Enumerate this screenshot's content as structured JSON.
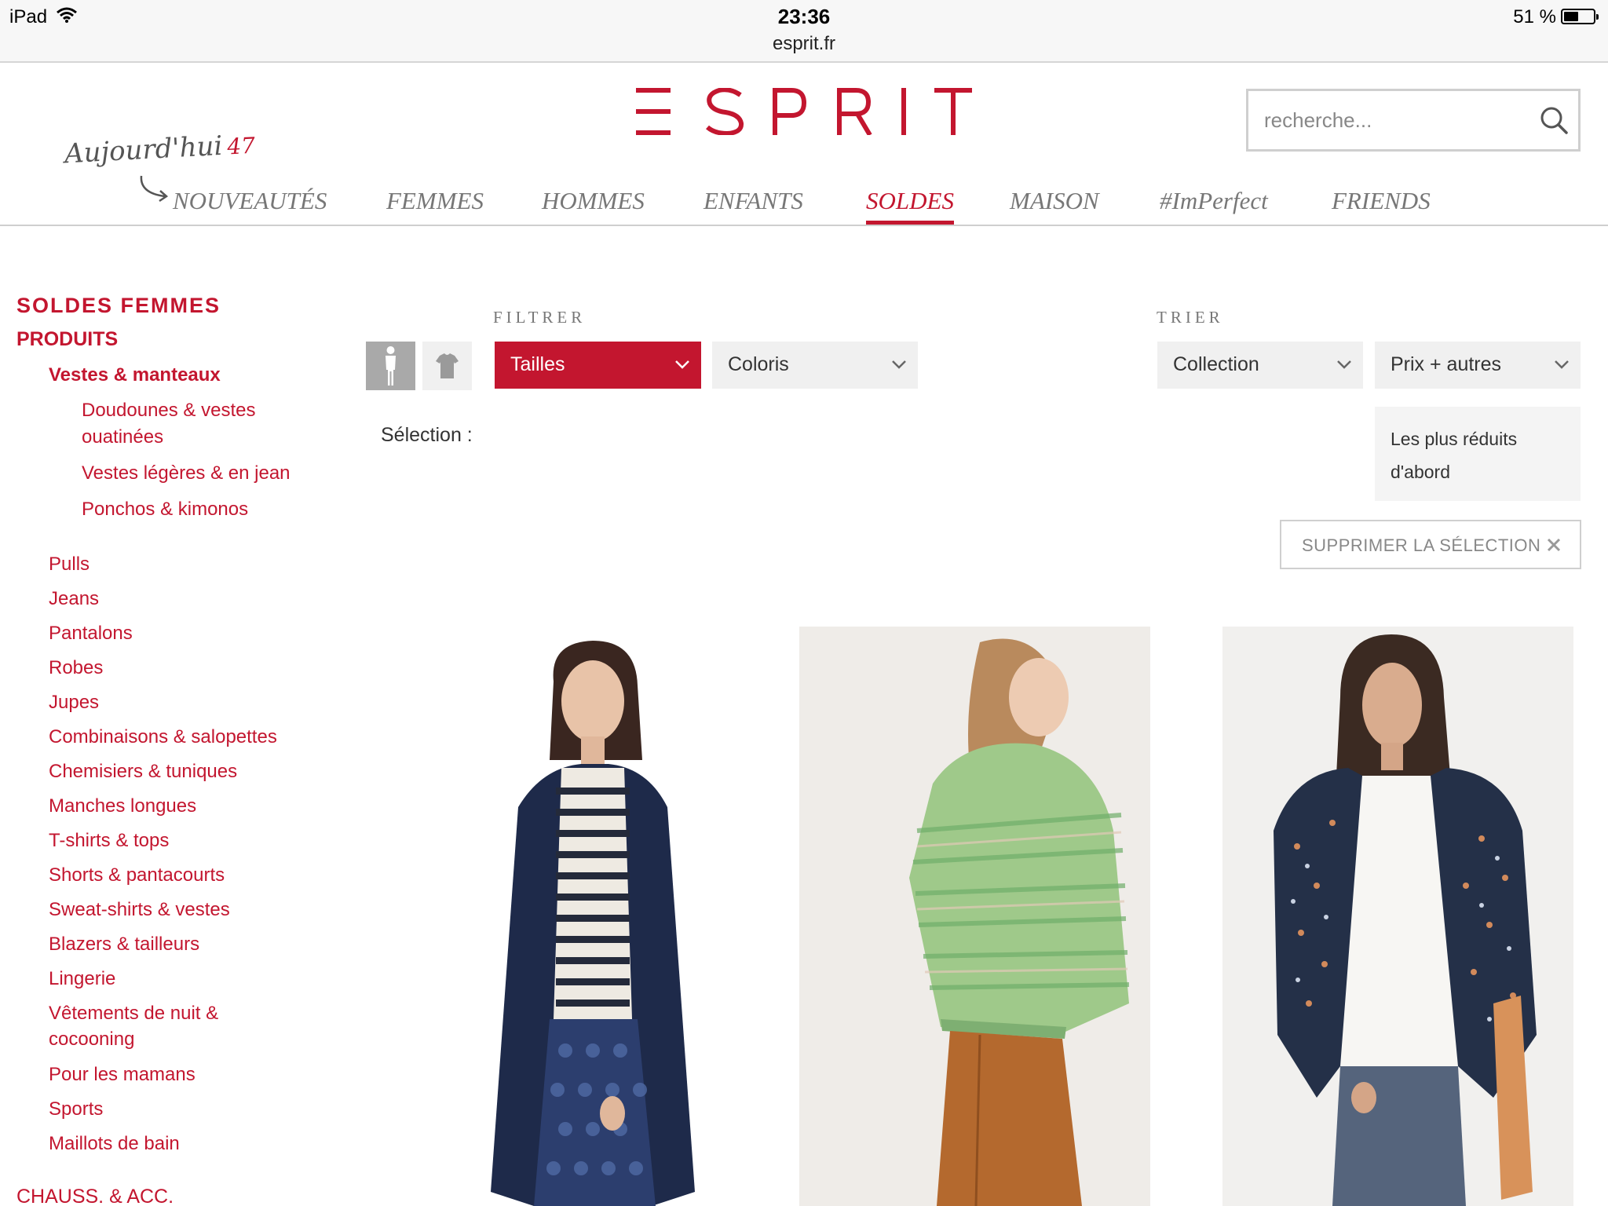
{
  "status_bar": {
    "device": "iPad",
    "time": "23:36",
    "url": "esprit.fr",
    "battery": "51 %",
    "battery_level": 0.51
  },
  "brand": {
    "logo": "ESPRIT",
    "accent_color": "#c3162f"
  },
  "search": {
    "placeholder": "recherche..."
  },
  "today_badge": {
    "label": "Aujourd'hui",
    "count": "47"
  },
  "nav": {
    "items": [
      "NOUVEAUTÉS",
      "FEMMES",
      "HOMMES",
      "ENFANTS",
      "SOLDES",
      "MAISON",
      "#ImPerfect",
      "FRIENDS"
    ],
    "active": "SOLDES"
  },
  "sidebar": {
    "title": "SOLDES FEMMES",
    "section": "PRODUITS",
    "active_category": "Vestes & manteaux",
    "subcategories": [
      "Doudounes & vestes ouatinées",
      "Vestes légères & en jean",
      "Ponchos & kimonos"
    ],
    "categories": [
      "Pulls",
      "Jeans",
      "Pantalons",
      "Robes",
      "Jupes",
      "Combinaisons & salopettes",
      "Chemisiers & tuniques",
      "Manches longues",
      "T-shirts & tops",
      "Shorts & pantacourts",
      "Sweat-shirts & vestes",
      "Blazers & tailleurs",
      "Lingerie",
      "Vêtements de nuit & cocooning",
      "Pour les mamans",
      "Sports",
      "Maillots de bain"
    ],
    "footer_section": "CHAUSS. & ACC."
  },
  "filters": {
    "label": "FILTRER",
    "view_model_icon": "model-view-icon",
    "view_product_icon": "product-view-icon",
    "sizes": "Tailles",
    "colors": "Coloris",
    "selection_label": "Sélection :",
    "clear_button": "SUPPRIMER LA SÉLECTION"
  },
  "sort": {
    "label": "TRIER",
    "collection": "Collection",
    "price": "Prix + autres",
    "option": "Les plus réduits d'abord"
  },
  "products": [
    {
      "image": "woman in navy cardigan, striped top and blue patterned skirt"
    },
    {
      "image": "woman in green patterned bomber jacket and tan leather skirt"
    },
    {
      "image": "woman in floral print kimono, white t-shirt and jeans"
    }
  ]
}
